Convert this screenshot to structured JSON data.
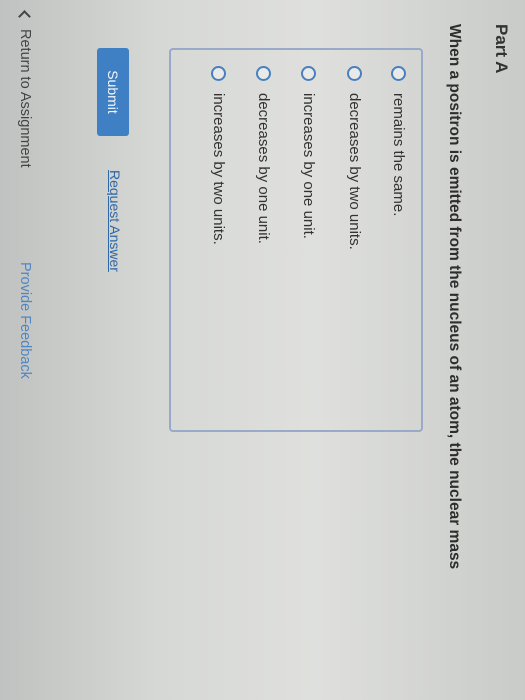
{
  "part": {
    "title": "Part A"
  },
  "question": {
    "text": "When a positron is emitted from the nucleus of an atom, the nuclear mass"
  },
  "options": [
    {
      "label": "remains the same."
    },
    {
      "label": "decreases by two units."
    },
    {
      "label": "increases by one unit."
    },
    {
      "label": "decreases by one unit."
    },
    {
      "label": "increases by two units."
    }
  ],
  "actions": {
    "submit_label": "Submit",
    "request_answer_label": "Request Answer"
  },
  "footer": {
    "return_label": "Return to Assignment",
    "feedback_label": "Provide Feedback"
  },
  "colors": {
    "accent": "#3f80c4",
    "link": "#2f68a8",
    "box_border": "#9aa9c8"
  },
  "icons": {
    "radio": "radio-unchecked-icon",
    "back": "chevron-left-icon"
  }
}
